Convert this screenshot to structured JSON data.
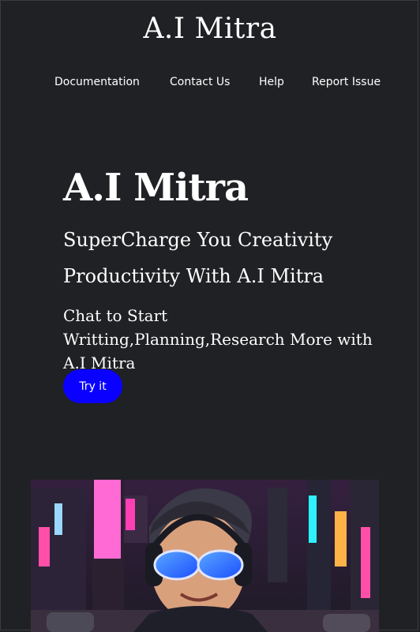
{
  "header": {
    "site_title": "A.I Mitra"
  },
  "nav": {
    "items": [
      {
        "label": "Documentation"
      },
      {
        "label": "Contact Us"
      },
      {
        "label": "Help"
      },
      {
        "label": "Report Issue"
      }
    ]
  },
  "hero": {
    "title": "A.I Mitra",
    "subtitle_line1": "SuperCharge You Creativity",
    "subtitle_line2": "Productivity With A.I Mitra",
    "description": "Chat to Start Writting,Planning,Research More with A.I Mitra",
    "cta_label": "Try it"
  },
  "image": {
    "subject": "child-with-headphones-neon-city-illustration"
  },
  "colors": {
    "background": "#202124",
    "button": "#0a00ff",
    "text": "#ffffff"
  }
}
